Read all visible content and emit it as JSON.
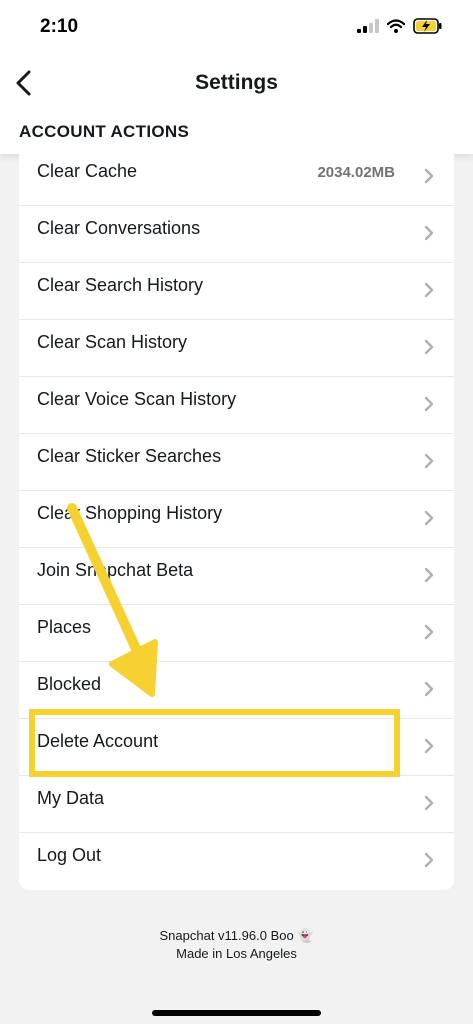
{
  "status": {
    "time": "2:10"
  },
  "header": {
    "title": "Settings",
    "section_title": "ACCOUNT ACTIONS"
  },
  "rows": [
    {
      "label": "Clear Cache",
      "value": "2034.02MB"
    },
    {
      "label": "Clear Conversations"
    },
    {
      "label": "Clear Search History"
    },
    {
      "label": "Clear Scan History"
    },
    {
      "label": "Clear Voice Scan History"
    },
    {
      "label": "Clear Sticker Searches"
    },
    {
      "label": "Clear Shopping History"
    },
    {
      "label": "Join Snapchat Beta"
    },
    {
      "label": "Places"
    },
    {
      "label": "Blocked"
    },
    {
      "label": "Delete Account"
    },
    {
      "label": "My Data"
    },
    {
      "label": "Log Out"
    }
  ],
  "footer": {
    "version": "Snapchat v11.96.0 Boo 👻",
    "origin": "Made in Los Angeles"
  },
  "colors": {
    "accent_highlight": "#f5d132",
    "text": "#16191c",
    "background": "#f2f2f2",
    "battery": "#f5d132"
  },
  "icons": [
    "signal-icon",
    "wifi-icon",
    "battery-charging-icon",
    "back-chevron-icon",
    "chevron-right-icon"
  ]
}
